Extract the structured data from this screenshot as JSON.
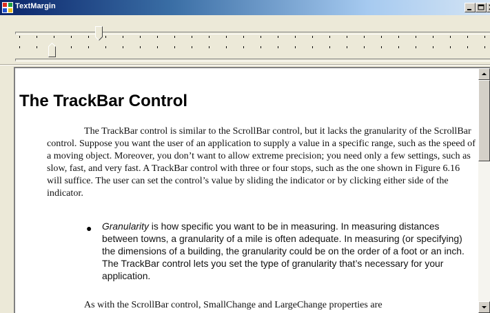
{
  "window": {
    "title": "TextMargin",
    "minimize_glyph": "minimize-icon",
    "maximize_glyph": "maximize-icon",
    "close_glyph": "close-icon"
  },
  "trackbars": {
    "top": {
      "value_fraction": 0.17,
      "tick_count": 28
    },
    "bottom": {
      "value_fraction": 0.07,
      "tick_count": 28
    }
  },
  "document": {
    "heading": "The TrackBar Control",
    "paragraph1": "The TrackBar control is similar to the ScrollBar control, but it lacks the granularity of the ScrollBar control. Suppose you want the user of an application to supply a value in a specific range, such as the speed of a moving object. Moreover, you don’t want to allow extreme precision; you need only a few settings, such as slow, fast, and very fast. A TrackBar control with three or four stops, such as the one shown in Figure 6.16 will suffice. The user can set the control’s value by sliding the indicator or by clicking either side of the indicator.",
    "bullet_term": "Granularity",
    "bullet_text": " is how specific you want to be in measuring. In measuring distances between towns, a granularity of a mile is often adequate. In measuring (or specifying) the dimensions of a building, the granularity could be on the order of a foot or an inch. The TrackBar control lets you set the type of granularity that’s necessary for your application.",
    "paragraph2": "As with the ScrollBar control, SmallChange and LargeChange properties are"
  },
  "scrollbar": {
    "position_fraction": 0.0
  },
  "colors": {
    "title_start": "#0a246a",
    "title_end": "#d4e4f4",
    "face": "#ece9d8",
    "doc_bg": "#ffffff"
  }
}
